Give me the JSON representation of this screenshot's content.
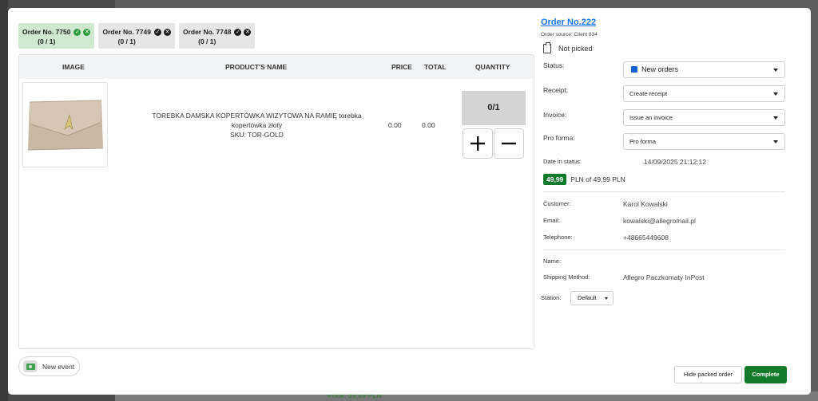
{
  "backdrop": {
    "price_text": "Price: 59,99 PLN"
  },
  "order_chips": [
    {
      "title": "Order No. 7750",
      "progress": "(0 / 1)",
      "active": true
    },
    {
      "title": "Order No. 7749",
      "progress": "(0 / 1)",
      "active": false
    },
    {
      "title": "Order No. 7748",
      "progress": "(0 / 1)",
      "active": false
    }
  ],
  "table": {
    "headers": {
      "image": "IMAGE",
      "name": "PRODUCT'S NAME",
      "price": "PRICE",
      "total": "TOTAL",
      "quantity": "QUANTITY"
    },
    "rows": [
      {
        "name": "TOREBKA DAMSKA KOPERTÓWKA WIZYTOWA NA RAMIĘ torebka kopertówka złoty",
        "sku": "SKU: TOR-GOLD",
        "price": "0.00",
        "total": "0.00",
        "quantity": "0/1"
      }
    ]
  },
  "new_event": {
    "label": "New event"
  },
  "order": {
    "title": "Order No.222",
    "source": "Order source: Client 834",
    "pick_status": "Not picked",
    "status_label": "Status:",
    "status_value": "New orders",
    "status_color": "#1565d8",
    "receipt_label": "Receipt:",
    "receipt_value": "Create receipt",
    "invoice_label": "Invoice:",
    "invoice_value": "Issue an invoice",
    "proforma_label": "Pro forma:",
    "proforma_value": "Pro forma",
    "date_label": "Date in status:",
    "date_value": "14/09/2025 21:12:12",
    "paid_amount": "49,99",
    "paid_text": "PLN  of 49,99 PLN",
    "customer_label": "Customer:",
    "customer_value": "Karol Kowalski",
    "email_label": "Email:",
    "email_value": "kowalski@allegromail.pl",
    "telephone_label": "Telephone:",
    "telephone_value": "+48665449608",
    "name_label": "Name:",
    "shipping_label": "Shipping Method:",
    "shipping_value": "Allegro Paczkomaty InPost",
    "station_label": "Station:",
    "station_value": "Default"
  },
  "actions": {
    "hide_label": "Hide packed order",
    "complete_label": "Complete"
  }
}
